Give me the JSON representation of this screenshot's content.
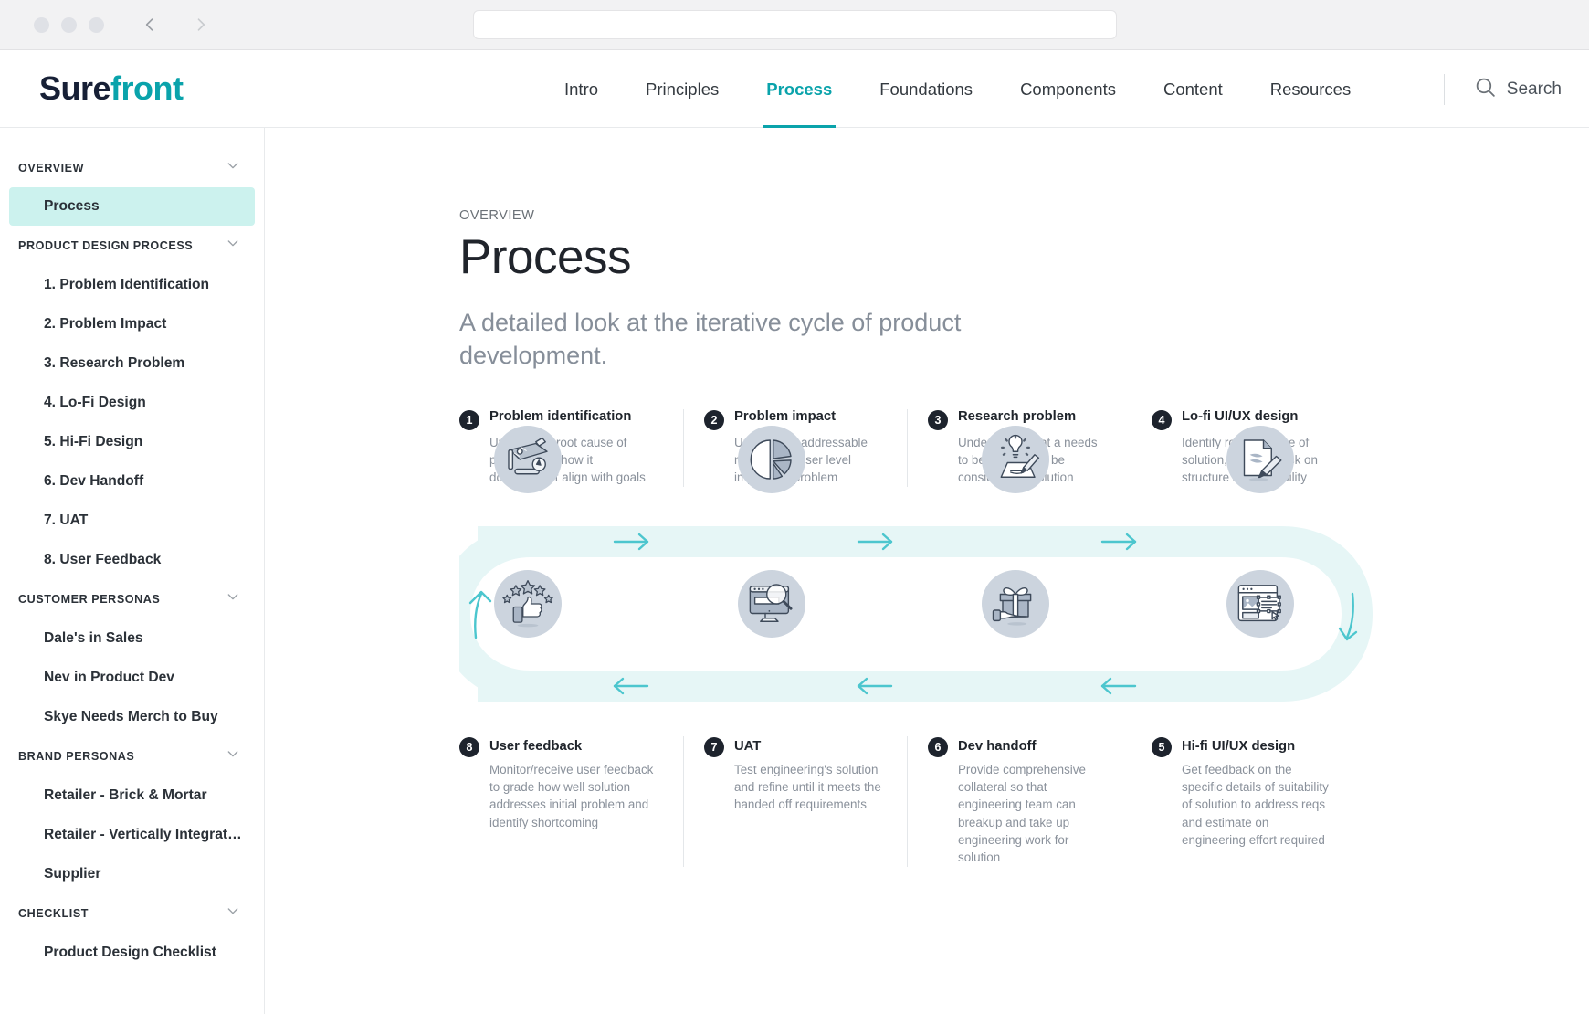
{
  "browser": {
    "traffic_dots": 3,
    "back_icon": "chevron-left-icon",
    "forward_icon": "chevron-right-icon",
    "url_value": "",
    "url_placeholder": ""
  },
  "header": {
    "logo_part1": "Sure",
    "logo_part2": "front",
    "nav": [
      {
        "label": "Intro",
        "active": false
      },
      {
        "label": "Principles",
        "active": false
      },
      {
        "label": "Process",
        "active": true
      },
      {
        "label": "Foundations",
        "active": false
      },
      {
        "label": "Components",
        "active": false
      },
      {
        "label": "Content",
        "active": false
      },
      {
        "label": "Resources",
        "active": false
      }
    ],
    "search_label": "Search",
    "search_icon": "search-icon"
  },
  "colors": {
    "accent_teal": "#0aa3ab",
    "logo_navy": "#172036",
    "sidebar_active_bg": "#ccf2ee",
    "flow_band": "#e6f6f6",
    "arrow_teal": "#4cc6ce",
    "icon_circle": "#ccd4de",
    "badge_bg": "#1d232d"
  },
  "sidebar": {
    "groups": [
      {
        "label": "OVERVIEW",
        "chevron": "chevron-down-icon",
        "items": [
          {
            "label": "Process",
            "active": true
          }
        ]
      },
      {
        "label": "PRODUCT DESIGN PROCESS",
        "chevron": "chevron-down-icon",
        "items": [
          {
            "label": "1. Problem Identification",
            "active": false
          },
          {
            "label": "2. Problem Impact",
            "active": false
          },
          {
            "label": "3. Research Problem",
            "active": false
          },
          {
            "label": "4. Lo-Fi Design",
            "active": false
          },
          {
            "label": "5. Hi-Fi Design",
            "active": false
          },
          {
            "label": "6. Dev Handoff",
            "active": false
          },
          {
            "label": "7. UAT",
            "active": false
          },
          {
            "label": "8. User Feedback",
            "active": false
          }
        ]
      },
      {
        "label": "CUSTOMER PERSONAS",
        "chevron": "chevron-down-icon",
        "items": [
          {
            "label": "Dale's in Sales",
            "active": false
          },
          {
            "label": "Nev in Product Dev",
            "active": false
          },
          {
            "label": "Skye Needs Merch to Buy",
            "active": false
          }
        ]
      },
      {
        "label": "BRAND PERSONAS",
        "chevron": "chevron-down-icon",
        "items": [
          {
            "label": "Retailer - Brick & Mortar",
            "active": false
          },
          {
            "label": "Retailer - Vertically Integrat…",
            "active": false
          },
          {
            "label": "Supplier",
            "active": false
          }
        ]
      },
      {
        "label": "CHECKLIST",
        "chevron": "chevron-down-icon",
        "items": [
          {
            "label": "Product Design Checklist",
            "active": false
          }
        ]
      }
    ]
  },
  "main": {
    "eyebrow": "OVERVIEW",
    "title": "Process",
    "subtitle": "A detailed look at the iterative cycle of product development."
  },
  "diagram": {
    "type": "cycle",
    "direction_top": "left-to-right",
    "direction_bottom": "right-to-left",
    "top_steps": [
      {
        "number": "1",
        "title": "Problem identification",
        "desc": "Understand root cause of problem and how it does/doesn't align with goals",
        "icon": "map-compass-pencil-icon"
      },
      {
        "number": "2",
        "title": "Problem impact",
        "desc": "Understand addressable market and user level impacts of problem",
        "icon": "pie-chart-icon"
      },
      {
        "number": "3",
        "title": "Research problem",
        "desc": "Understand what a needs to be included to be considered a solution",
        "icon": "lightbulb-pencil-icon"
      },
      {
        "number": "4",
        "title": "Lo-fi UI/UX design",
        "desc": "Identify rough outline of solution, get feedback on structure and feasibility",
        "icon": "document-pencil-icon"
      }
    ],
    "bottom_steps": [
      {
        "number": "8",
        "title": "User feedback",
        "desc": "Monitor/receive user feedback to grade how well solution addresses initial problem and identify shortcoming",
        "icon": "thumbs-up-stars-icon"
      },
      {
        "number": "7",
        "title": "UAT",
        "desc": "Test engineering's solution and refine until it meets the handed off requirements",
        "icon": "monitor-magnifier-icon"
      },
      {
        "number": "6",
        "title": "Dev handoff",
        "desc": "Provide comprehensive collateral so that engineering team can breakup and take up engineering work for solution",
        "icon": "gift-hand-icon"
      },
      {
        "number": "5",
        "title": "Hi-fi UI/UX design",
        "desc": "Get feedback on the specific details of suitability of solution to address reqs and estimate on engineering effort required",
        "icon": "wireframe-mockup-icon"
      }
    ],
    "arrows": {
      "top_right_arrows": 3,
      "bottom_left_arrows": 3,
      "right_curve": "arrow-down-icon",
      "left_curve": "arrow-up-icon"
    }
  }
}
